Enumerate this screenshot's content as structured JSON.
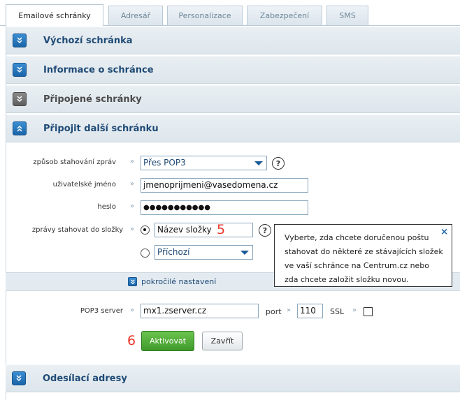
{
  "tabs": [
    "Emailové schránky",
    "Adresář",
    "Personalizace",
    "Zabezpečení",
    "SMS"
  ],
  "sections": {
    "default_mailbox": "Výchozí schránka",
    "mailbox_info": "Informace o schránce",
    "connected": "Připojené schránky",
    "connect_another": "Připojit další schránku",
    "sending_addresses": "Odesílací adresy"
  },
  "form": {
    "method_label": "způsob stahování zpráv",
    "method_value": "Přes POP3",
    "username_label": "uživatelské jméno",
    "username_value": "jmenoprijmeni@vasedomena.cz",
    "password_label": "heslo",
    "password_value": "●●●●●●●●●●●",
    "folder_label": "zprávy stahovat do složky",
    "folder_new_value": "Název složky",
    "folder_existing_value": "Příchozí",
    "help_glyph": "?",
    "raquo": "»"
  },
  "annotations": {
    "five": "5",
    "six": "6"
  },
  "tooltip": {
    "text": "Vyberte, zda chcete doručenou poštu stahovat do některé ze stávajících složek ve vaší schránce na Centrum.cz nebo zda chcete založit složku novou.",
    "close": "×"
  },
  "advanced": {
    "link": "pokročilé nastavení",
    "server_label": "POP3 server",
    "server_value": "mx1.zserver.cz",
    "port_label": "port",
    "port_value": "110",
    "ssl_label": "SSL"
  },
  "buttons": {
    "activate": "Aktivovat",
    "close": "Zavřít"
  },
  "colors": {
    "accent_blue": "#1b64a8",
    "title_blue": "#1f4a75",
    "green": "#3e9a2a",
    "annotation_red": "#e8372a"
  },
  "icons": {
    "expand": "chevron-double-down-icon",
    "collapse": "chevron-double-up-icon"
  }
}
